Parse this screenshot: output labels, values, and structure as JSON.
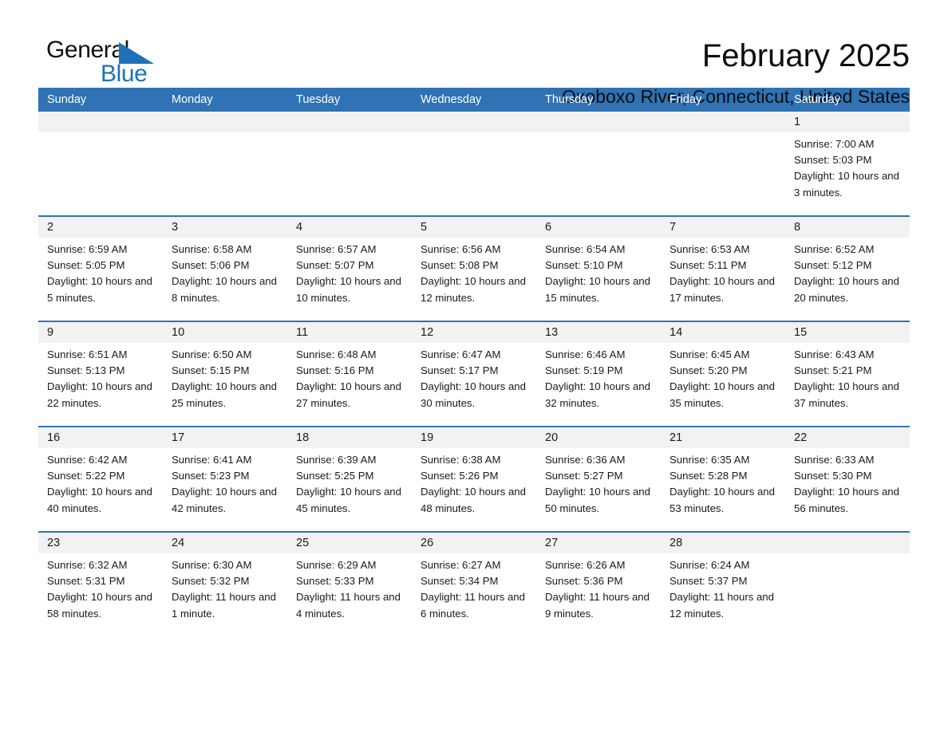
{
  "brand": {
    "name_part1": "General",
    "name_part2": "Blue",
    "triangle_icon": "triangle-icon",
    "accent_color": "#1c72b8"
  },
  "header": {
    "title": "February 2025",
    "subtitle": "Oxoboxo River, Connecticut, United States"
  },
  "theme": {
    "header_blue": "#3073b4",
    "band_gray": "#f2f2f2",
    "text": "#1a1a1a"
  },
  "calendar": {
    "weekday_headers": [
      "Sunday",
      "Monday",
      "Tuesday",
      "Wednesday",
      "Thursday",
      "Friday",
      "Saturday"
    ],
    "weeks": [
      [
        {
          "date": "",
          "sunrise": "",
          "sunset": "",
          "daylight": "",
          "empty": true
        },
        {
          "date": "",
          "sunrise": "",
          "sunset": "",
          "daylight": "",
          "empty": true
        },
        {
          "date": "",
          "sunrise": "",
          "sunset": "",
          "daylight": "",
          "empty": true
        },
        {
          "date": "",
          "sunrise": "",
          "sunset": "",
          "daylight": "",
          "empty": true
        },
        {
          "date": "",
          "sunrise": "",
          "sunset": "",
          "daylight": "",
          "empty": true
        },
        {
          "date": "",
          "sunrise": "",
          "sunset": "",
          "daylight": "",
          "empty": true
        },
        {
          "date": "1",
          "sunrise": "Sunrise: 7:00 AM",
          "sunset": "Sunset: 5:03 PM",
          "daylight": "Daylight: 10 hours and 3 minutes.",
          "empty": false
        }
      ],
      [
        {
          "date": "2",
          "sunrise": "Sunrise: 6:59 AM",
          "sunset": "Sunset: 5:05 PM",
          "daylight": "Daylight: 10 hours and 5 minutes.",
          "empty": false
        },
        {
          "date": "3",
          "sunrise": "Sunrise: 6:58 AM",
          "sunset": "Sunset: 5:06 PM",
          "daylight": "Daylight: 10 hours and 8 minutes.",
          "empty": false
        },
        {
          "date": "4",
          "sunrise": "Sunrise: 6:57 AM",
          "sunset": "Sunset: 5:07 PM",
          "daylight": "Daylight: 10 hours and 10 minutes.",
          "empty": false
        },
        {
          "date": "5",
          "sunrise": "Sunrise: 6:56 AM",
          "sunset": "Sunset: 5:08 PM",
          "daylight": "Daylight: 10 hours and 12 minutes.",
          "empty": false
        },
        {
          "date": "6",
          "sunrise": "Sunrise: 6:54 AM",
          "sunset": "Sunset: 5:10 PM",
          "daylight": "Daylight: 10 hours and 15 minutes.",
          "empty": false
        },
        {
          "date": "7",
          "sunrise": "Sunrise: 6:53 AM",
          "sunset": "Sunset: 5:11 PM",
          "daylight": "Daylight: 10 hours and 17 minutes.",
          "empty": false
        },
        {
          "date": "8",
          "sunrise": "Sunrise: 6:52 AM",
          "sunset": "Sunset: 5:12 PM",
          "daylight": "Daylight: 10 hours and 20 minutes.",
          "empty": false
        }
      ],
      [
        {
          "date": "9",
          "sunrise": "Sunrise: 6:51 AM",
          "sunset": "Sunset: 5:13 PM",
          "daylight": "Daylight: 10 hours and 22 minutes.",
          "empty": false
        },
        {
          "date": "10",
          "sunrise": "Sunrise: 6:50 AM",
          "sunset": "Sunset: 5:15 PM",
          "daylight": "Daylight: 10 hours and 25 minutes.",
          "empty": false
        },
        {
          "date": "11",
          "sunrise": "Sunrise: 6:48 AM",
          "sunset": "Sunset: 5:16 PM",
          "daylight": "Daylight: 10 hours and 27 minutes.",
          "empty": false
        },
        {
          "date": "12",
          "sunrise": "Sunrise: 6:47 AM",
          "sunset": "Sunset: 5:17 PM",
          "daylight": "Daylight: 10 hours and 30 minutes.",
          "empty": false
        },
        {
          "date": "13",
          "sunrise": "Sunrise: 6:46 AM",
          "sunset": "Sunset: 5:19 PM",
          "daylight": "Daylight: 10 hours and 32 minutes.",
          "empty": false
        },
        {
          "date": "14",
          "sunrise": "Sunrise: 6:45 AM",
          "sunset": "Sunset: 5:20 PM",
          "daylight": "Daylight: 10 hours and 35 minutes.",
          "empty": false
        },
        {
          "date": "15",
          "sunrise": "Sunrise: 6:43 AM",
          "sunset": "Sunset: 5:21 PM",
          "daylight": "Daylight: 10 hours and 37 minutes.",
          "empty": false
        }
      ],
      [
        {
          "date": "16",
          "sunrise": "Sunrise: 6:42 AM",
          "sunset": "Sunset: 5:22 PM",
          "daylight": "Daylight: 10 hours and 40 minutes.",
          "empty": false
        },
        {
          "date": "17",
          "sunrise": "Sunrise: 6:41 AM",
          "sunset": "Sunset: 5:23 PM",
          "daylight": "Daylight: 10 hours and 42 minutes.",
          "empty": false
        },
        {
          "date": "18",
          "sunrise": "Sunrise: 6:39 AM",
          "sunset": "Sunset: 5:25 PM",
          "daylight": "Daylight: 10 hours and 45 minutes.",
          "empty": false
        },
        {
          "date": "19",
          "sunrise": "Sunrise: 6:38 AM",
          "sunset": "Sunset: 5:26 PM",
          "daylight": "Daylight: 10 hours and 48 minutes.",
          "empty": false
        },
        {
          "date": "20",
          "sunrise": "Sunrise: 6:36 AM",
          "sunset": "Sunset: 5:27 PM",
          "daylight": "Daylight: 10 hours and 50 minutes.",
          "empty": false
        },
        {
          "date": "21",
          "sunrise": "Sunrise: 6:35 AM",
          "sunset": "Sunset: 5:28 PM",
          "daylight": "Daylight: 10 hours and 53 minutes.",
          "empty": false
        },
        {
          "date": "22",
          "sunrise": "Sunrise: 6:33 AM",
          "sunset": "Sunset: 5:30 PM",
          "daylight": "Daylight: 10 hours and 56 minutes.",
          "empty": false
        }
      ],
      [
        {
          "date": "23",
          "sunrise": "Sunrise: 6:32 AM",
          "sunset": "Sunset: 5:31 PM",
          "daylight": "Daylight: 10 hours and 58 minutes.",
          "empty": false
        },
        {
          "date": "24",
          "sunrise": "Sunrise: 6:30 AM",
          "sunset": "Sunset: 5:32 PM",
          "daylight": "Daylight: 11 hours and 1 minute.",
          "empty": false
        },
        {
          "date": "25",
          "sunrise": "Sunrise: 6:29 AM",
          "sunset": "Sunset: 5:33 PM",
          "daylight": "Daylight: 11 hours and 4 minutes.",
          "empty": false
        },
        {
          "date": "26",
          "sunrise": "Sunrise: 6:27 AM",
          "sunset": "Sunset: 5:34 PM",
          "daylight": "Daylight: 11 hours and 6 minutes.",
          "empty": false
        },
        {
          "date": "27",
          "sunrise": "Sunrise: 6:26 AM",
          "sunset": "Sunset: 5:36 PM",
          "daylight": "Daylight: 11 hours and 9 minutes.",
          "empty": false
        },
        {
          "date": "28",
          "sunrise": "Sunrise: 6:24 AM",
          "sunset": "Sunset: 5:37 PM",
          "daylight": "Daylight: 11 hours and 12 minutes.",
          "empty": false
        },
        {
          "date": "",
          "sunrise": "",
          "sunset": "",
          "daylight": "",
          "empty": true
        }
      ]
    ]
  }
}
